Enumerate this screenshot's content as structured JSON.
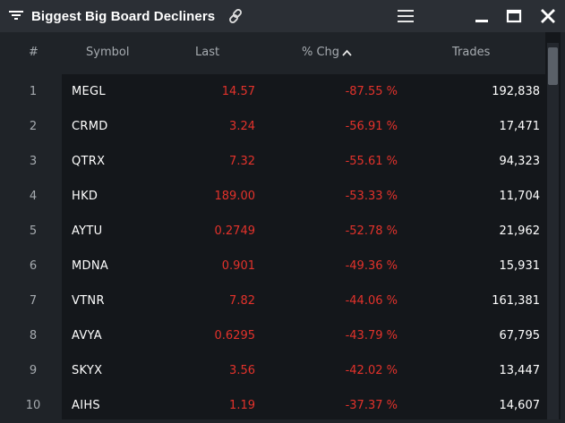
{
  "window": {
    "title": "Biggest Big Board Decliners",
    "icons": [
      "filter-icon",
      "link-icon",
      "menu-icon",
      "minimize-icon",
      "maximize-icon",
      "close-icon"
    ]
  },
  "table": {
    "headers": {
      "num": "#",
      "symbol": "Symbol",
      "last": "Last",
      "chg": "% Chg",
      "trades": "Trades"
    },
    "sort": {
      "column": "chg",
      "direction": "ascending"
    },
    "rows": [
      {
        "num": "1",
        "symbol": "MEGL",
        "last": "14.57",
        "chg": "-87.55 %",
        "trades": "192,838"
      },
      {
        "num": "2",
        "symbol": "CRMD",
        "last": "3.24",
        "chg": "-56.91 %",
        "trades": "17,471"
      },
      {
        "num": "3",
        "symbol": "QTRX",
        "last": "7.32",
        "chg": "-55.61 %",
        "trades": "94,323"
      },
      {
        "num": "4",
        "symbol": "HKD",
        "last": "189.00",
        "chg": "-53.33 %",
        "trades": "11,704"
      },
      {
        "num": "5",
        "symbol": "AYTU",
        "last": "0.2749",
        "chg": "-52.78 %",
        "trades": "21,962"
      },
      {
        "num": "6",
        "symbol": "MDNA",
        "last": "0.901",
        "chg": "-49.36 %",
        "trades": "15,931"
      },
      {
        "num": "7",
        "symbol": "VTNR",
        "last": "7.82",
        "chg": "-44.06 %",
        "trades": "161,381"
      },
      {
        "num": "8",
        "symbol": "AVYA",
        "last": "0.6295",
        "chg": "-43.79 %",
        "trades": "67,795"
      },
      {
        "num": "9",
        "symbol": "SKYX",
        "last": "3.56",
        "chg": "-42.02 %",
        "trades": "13,447"
      },
      {
        "num": "10",
        "symbol": "AIHS",
        "last": "1.19",
        "chg": "-37.37 %",
        "trades": "14,607"
      }
    ]
  },
  "colors": {
    "negative": "#e3322b",
    "text": "#ffffff",
    "header_text": "#a6abb0",
    "titlebar_bg": "#2b2f35",
    "panel_bg": "#14171b"
  }
}
